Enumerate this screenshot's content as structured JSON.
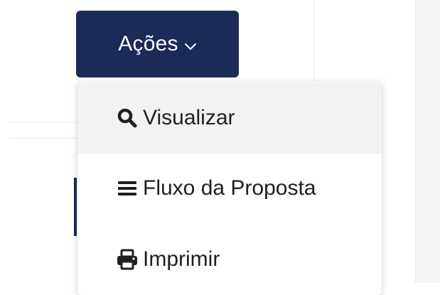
{
  "actions": {
    "label": "Ações",
    "background": "#1b2a57"
  },
  "menu": {
    "items": [
      {
        "label": "Visualizar",
        "icon": "search-icon"
      },
      {
        "label": "Fluxo da Proposta",
        "icon": "list-icon"
      },
      {
        "label": "Imprimir",
        "icon": "print-icon"
      }
    ]
  }
}
